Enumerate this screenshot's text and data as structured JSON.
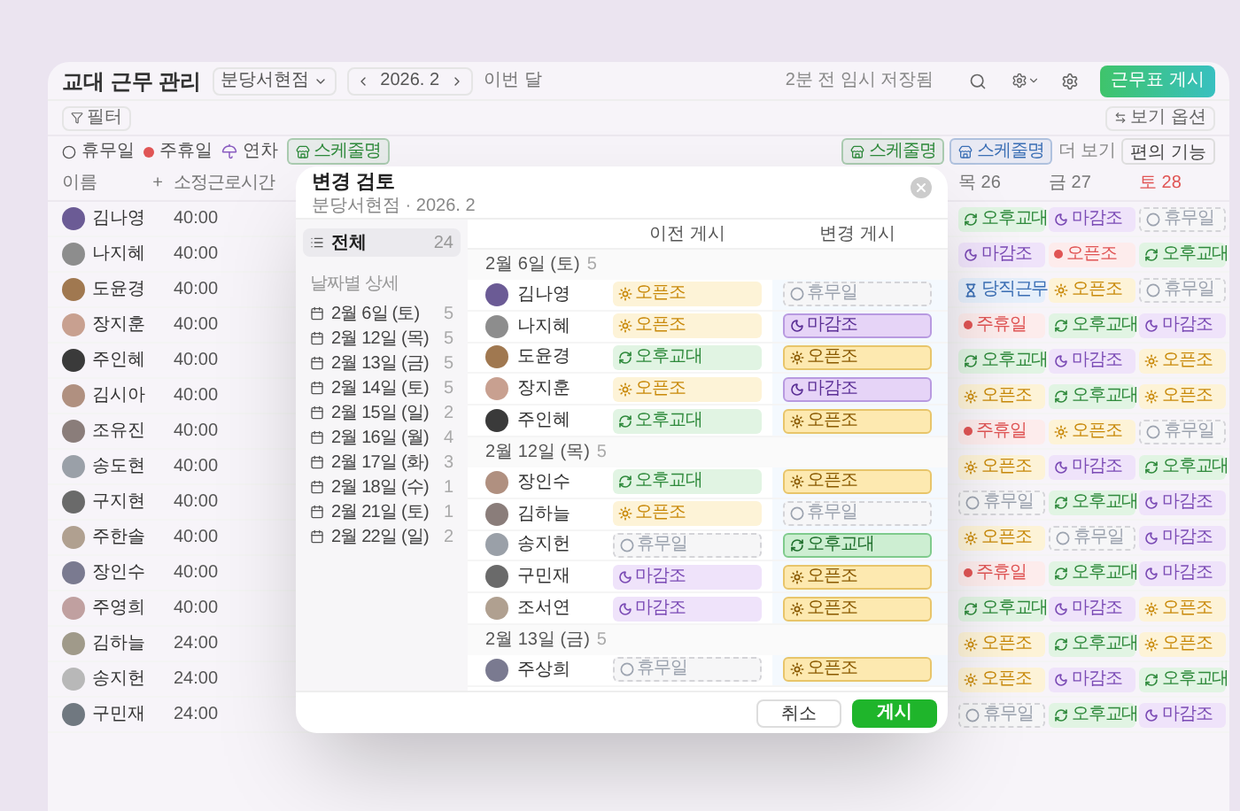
{
  "header": {
    "title": "교대 근무 관리",
    "branch": "분당서현점",
    "month": "2026. 2",
    "today_label": "이번 달",
    "save_status": "2분 전 임시 저장됨",
    "publish_button": "근무표 게시"
  },
  "toolbar": {
    "filter": "필터",
    "view_options": "보기 옵션"
  },
  "legend_left": [
    {
      "kind": "off",
      "label": "휴무일"
    },
    {
      "kind": "weekly",
      "label": "주휴일"
    },
    {
      "kind": "leave",
      "label": "연차"
    },
    {
      "kind": "schedule",
      "label": "스케줄명",
      "color": "#2f8a3c"
    }
  ],
  "legend_right": [
    {
      "kind": "schedule",
      "label": "스케줄명",
      "color": "#2f8a3c"
    },
    {
      "kind": "schedule",
      "label": "스케줄명",
      "color": "#3b6fb5"
    },
    {
      "kind": "link",
      "label": "더 보기"
    },
    {
      "kind": "button",
      "label": "편의 기능"
    }
  ],
  "table": {
    "name_column": "이름",
    "add_column": "+",
    "hours_column": "소정근로시간",
    "days": [
      {
        "label": "목 26",
        "weekend": false
      },
      {
        "label": "금 27",
        "weekend": false
      },
      {
        "label": "토 28",
        "weekend": true
      }
    ],
    "rows": [
      {
        "name": "김나영",
        "hours": "40:00",
        "shifts": [
          {
            "kind": "afternoon",
            "label": "오후교대"
          },
          {
            "kind": "close",
            "label": "마감조"
          },
          {
            "kind": "off",
            "label": "휴무일"
          }
        ]
      },
      {
        "name": "나지혜",
        "hours": "40:00",
        "shifts": [
          {
            "kind": "close",
            "label": "마감조"
          },
          {
            "kind": "weekly",
            "label": "오픈조"
          },
          {
            "kind": "afternoon",
            "label": "오후교대"
          }
        ]
      },
      {
        "name": "도윤경",
        "hours": "40:00",
        "shifts": [
          {
            "kind": "duty",
            "label": "당직근무"
          },
          {
            "kind": "open",
            "label": "오픈조"
          },
          {
            "kind": "off",
            "label": "휴무일"
          }
        ]
      },
      {
        "name": "장지훈",
        "hours": "40:00",
        "shifts": [
          {
            "kind": "weekly",
            "label": "주휴일"
          },
          {
            "kind": "afternoon",
            "label": "오후교대"
          },
          {
            "kind": "close",
            "label": "마감조"
          }
        ]
      },
      {
        "name": "주인혜",
        "hours": "40:00",
        "shifts": [
          {
            "kind": "afternoon",
            "label": "오후교대"
          },
          {
            "kind": "close",
            "label": "마감조"
          },
          {
            "kind": "open",
            "label": "오픈조"
          }
        ]
      },
      {
        "name": "김시아",
        "hours": "40:00",
        "shifts": [
          {
            "kind": "open",
            "label": "오픈조"
          },
          {
            "kind": "afternoon",
            "label": "오후교대"
          },
          {
            "kind": "open",
            "label": "오픈조"
          }
        ]
      },
      {
        "name": "조유진",
        "hours": "40:00",
        "shifts": [
          {
            "kind": "weekly",
            "label": "주휴일"
          },
          {
            "kind": "open",
            "label": "오픈조"
          },
          {
            "kind": "off",
            "label": "휴무일"
          }
        ]
      },
      {
        "name": "송도현",
        "hours": "40:00",
        "shifts": [
          {
            "kind": "open",
            "label": "오픈조"
          },
          {
            "kind": "close",
            "label": "마감조"
          },
          {
            "kind": "afternoon",
            "label": "오후교대"
          }
        ]
      },
      {
        "name": "구지현",
        "hours": "40:00",
        "shifts": [
          {
            "kind": "off",
            "label": "휴무일"
          },
          {
            "kind": "afternoon",
            "label": "오후교대"
          },
          {
            "kind": "close",
            "label": "마감조"
          }
        ]
      },
      {
        "name": "주한솔",
        "hours": "40:00",
        "shifts": [
          {
            "kind": "open",
            "label": "오픈조"
          },
          {
            "kind": "off",
            "label": "휴무일"
          },
          {
            "kind": "close",
            "label": "마감조"
          }
        ]
      },
      {
        "name": "장인수",
        "hours": "40:00",
        "shifts": [
          {
            "kind": "weekly",
            "label": "주휴일"
          },
          {
            "kind": "afternoon",
            "label": "오후교대"
          },
          {
            "kind": "close",
            "label": "마감조"
          }
        ]
      },
      {
        "name": "주영희",
        "hours": "40:00",
        "shifts": [
          {
            "kind": "afternoon",
            "label": "오후교대"
          },
          {
            "kind": "close",
            "label": "마감조"
          },
          {
            "kind": "open",
            "label": "오픈조"
          }
        ]
      },
      {
        "name": "김하늘",
        "hours": "24:00",
        "shifts": [
          {
            "kind": "open",
            "label": "오픈조"
          },
          {
            "kind": "afternoon",
            "label": "오후교대"
          },
          {
            "kind": "open",
            "label": "오픈조"
          }
        ]
      },
      {
        "name": "송지헌",
        "hours": "24:00",
        "shifts": [
          {
            "kind": "open",
            "label": "오픈조"
          },
          {
            "kind": "close",
            "label": "마감조"
          },
          {
            "kind": "afternoon",
            "label": "오후교대"
          }
        ]
      },
      {
        "name": "구민재",
        "hours": "24:00",
        "shifts": [
          {
            "kind": "off",
            "label": "휴무일"
          },
          {
            "kind": "afternoon",
            "label": "오후교대"
          },
          {
            "kind": "close",
            "label": "마감조"
          }
        ]
      }
    ]
  },
  "modal": {
    "title": "변경 검토",
    "subtitle": "분당서현점 · 2026. 2",
    "all": {
      "label": "전체",
      "count": "24",
      "selected": true
    },
    "section": "날짜별 상세",
    "dates": [
      {
        "label": "2월 6일 (토)",
        "count": "5",
        "selected": false
      },
      {
        "label": "2월 12일 (목)",
        "count": "5",
        "selected": false
      },
      {
        "label": "2월 13일 (금)",
        "count": "5",
        "selected": false
      },
      {
        "label": "2월 14일 (토)",
        "count": "5",
        "selected": false
      },
      {
        "label": "2월 15일 (일)",
        "count": "2",
        "selected": false
      },
      {
        "label": "2월 16일 (월)",
        "count": "4",
        "selected": false
      },
      {
        "label": "2월 17일 (화)",
        "count": "3",
        "selected": false
      },
      {
        "label": "2월 18일 (수)",
        "count": "1",
        "selected": false
      },
      {
        "label": "2월 21일 (토)",
        "count": "1",
        "selected": false
      },
      {
        "label": "2월 22일 (일)",
        "count": "2",
        "selected": false
      }
    ],
    "columns": [
      "이전 게시",
      "변경 게시"
    ],
    "groups": [
      {
        "date": "2월 6일 (토)",
        "count": "5",
        "rows": [
          {
            "name": "김나영",
            "before": {
              "kind": "open",
              "label": "오픈조"
            },
            "after": {
              "kind": "off",
              "label": "휴무일"
            }
          },
          {
            "name": "나지혜",
            "before": {
              "kind": "open",
              "label": "오픈조"
            },
            "after": {
              "kind": "close",
              "label": "마감조"
            }
          },
          {
            "name": "도윤경",
            "before": {
              "kind": "afternoon",
              "label": "오후교대"
            },
            "after": {
              "kind": "open",
              "label": "오픈조"
            }
          },
          {
            "name": "장지훈",
            "before": {
              "kind": "open",
              "label": "오픈조"
            },
            "after": {
              "kind": "close",
              "label": "마감조"
            }
          },
          {
            "name": "주인혜",
            "before": {
              "kind": "afternoon",
              "label": "오후교대"
            },
            "after": {
              "kind": "open",
              "label": "오픈조"
            }
          }
        ]
      },
      {
        "date": "2월 12일 (목)",
        "count": "5",
        "rows": [
          {
            "name": "장인수",
            "before": {
              "kind": "afternoon",
              "label": "오후교대"
            },
            "after": {
              "kind": "open",
              "label": "오픈조"
            }
          },
          {
            "name": "김하늘",
            "before": {
              "kind": "open",
              "label": "오픈조"
            },
            "after": {
              "kind": "off",
              "label": "휴무일"
            }
          },
          {
            "name": "송지헌",
            "before": {
              "kind": "off",
              "label": "휴무일"
            },
            "after": {
              "kind": "afternoon",
              "label": "오후교대"
            }
          },
          {
            "name": "구민재",
            "before": {
              "kind": "close",
              "label": "마감조"
            },
            "after": {
              "kind": "open",
              "label": "오픈조"
            }
          },
          {
            "name": "조서연",
            "before": {
              "kind": "close",
              "label": "마감조"
            },
            "after": {
              "kind": "open",
              "label": "오픈조"
            }
          }
        ]
      },
      {
        "date": "2월 13일 (금)",
        "count": "5",
        "rows": [
          {
            "name": "주상희",
            "before": {
              "kind": "off",
              "label": "휴무일"
            },
            "after": {
              "kind": "open",
              "label": "오픈조"
            }
          }
        ]
      }
    ],
    "cancel_button": "취소",
    "submit_button": "게시"
  }
}
